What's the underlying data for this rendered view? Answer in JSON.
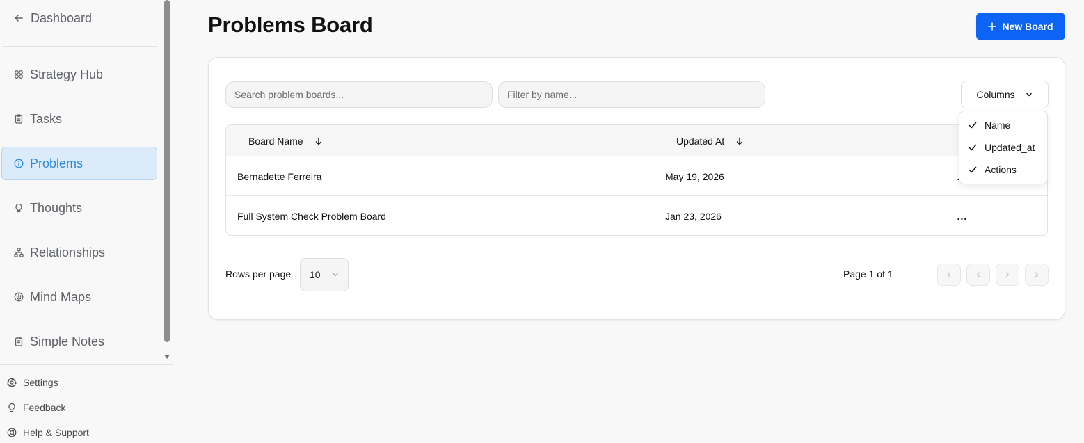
{
  "sidebar": {
    "back_label": "Dashboard",
    "items": [
      {
        "label": "Strategy Hub",
        "icon": "strategy-icon"
      },
      {
        "label": "Tasks",
        "icon": "clipboard-icon"
      },
      {
        "label": "Problems",
        "icon": "info-circle-icon",
        "active": true
      },
      {
        "label": "Thoughts",
        "icon": "lightbulb-icon"
      },
      {
        "label": "Relationships",
        "icon": "network-icon"
      },
      {
        "label": "Mind Maps",
        "icon": "brain-icon"
      },
      {
        "label": "Simple Notes",
        "icon": "notes-icon"
      }
    ],
    "footer": [
      {
        "label": "Settings",
        "icon": "gear-icon"
      },
      {
        "label": "Feedback",
        "icon": "lightbulb-icon"
      },
      {
        "label": "Help & Support",
        "icon": "lifebuoy-icon"
      }
    ]
  },
  "header": {
    "title": "Problems Board",
    "new_board_label": "New Board"
  },
  "toolbar": {
    "search_placeholder": "Search problem boards...",
    "filter_placeholder": "Filter by name...",
    "columns_label": "Columns"
  },
  "columns_menu": {
    "items": [
      {
        "label": "Name",
        "checked": true
      },
      {
        "label": "Updated_at",
        "checked": true
      },
      {
        "label": "Actions",
        "checked": true
      }
    ]
  },
  "table": {
    "headers": {
      "name": "Board Name",
      "updated": "Updated At"
    },
    "rows": [
      {
        "name": "Bernadette Ferreira",
        "updated": "May 19, 2026",
        "actions": "..."
      },
      {
        "name": "Full System Check Problem Board",
        "updated": "Jan 23, 2026",
        "actions": "..."
      }
    ]
  },
  "pagination": {
    "rows_label": "Rows per page",
    "rows_value": "10",
    "page_info": "Page 1 of 1"
  },
  "colors": {
    "primary": "#0b64f4",
    "active_bg": "#dcebfa",
    "active_text": "#2b8ae0"
  }
}
